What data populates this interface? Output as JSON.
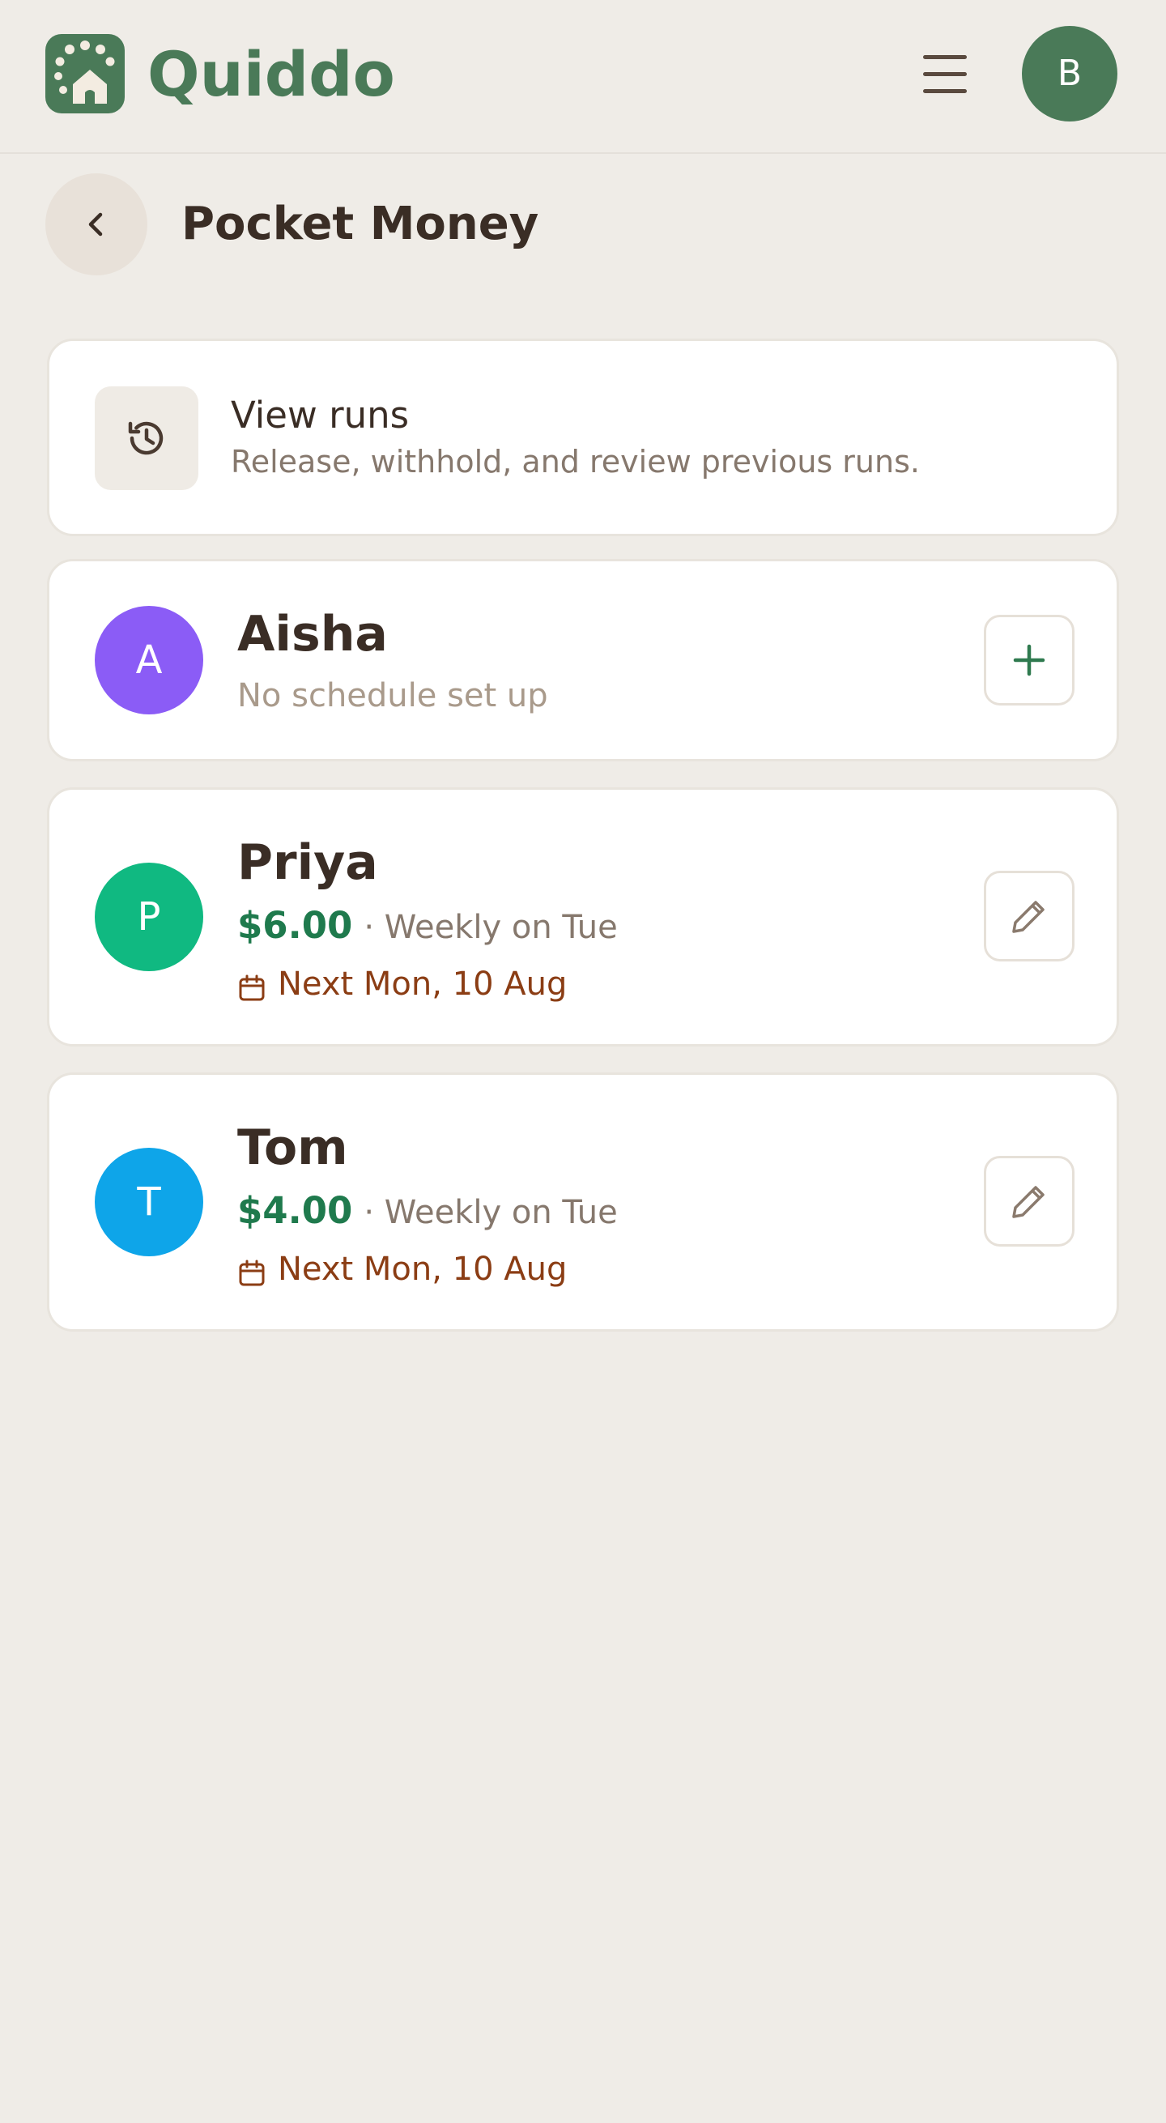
{
  "header": {
    "brand": "Quiddo",
    "user_initial": "B"
  },
  "page": {
    "title": "Pocket Money"
  },
  "runs_card": {
    "title": "View runs",
    "subtitle": "Release, withhold, and review previous runs."
  },
  "children": [
    {
      "initial": "A",
      "name": "Aisha",
      "note": "No schedule set up",
      "avatar_color": "#8b5cf6",
      "action": "add"
    },
    {
      "initial": "P",
      "name": "Priya",
      "amount": "$6.00",
      "frequency": "· Weekly on Tue",
      "next": "Next Mon, 10 Aug",
      "avatar_color": "#10b981",
      "action": "edit"
    },
    {
      "initial": "T",
      "name": "Tom",
      "amount": "$4.00",
      "frequency": "· Weekly on Tue",
      "next": "Next Mon, 10 Aug",
      "avatar_color": "#0ea5e9",
      "action": "edit"
    }
  ],
  "colors": {
    "brand": "#4a7a58",
    "background": "#efece7",
    "amount": "#1f7a4d",
    "next_date": "#8b3d14"
  },
  "icons": {
    "logo": "house-dots-icon",
    "menu": "hamburger-menu-icon",
    "back": "chevron-left-icon",
    "runs": "history-icon",
    "add": "plus-icon",
    "edit": "pencil-icon",
    "calendar": "calendar-icon"
  }
}
